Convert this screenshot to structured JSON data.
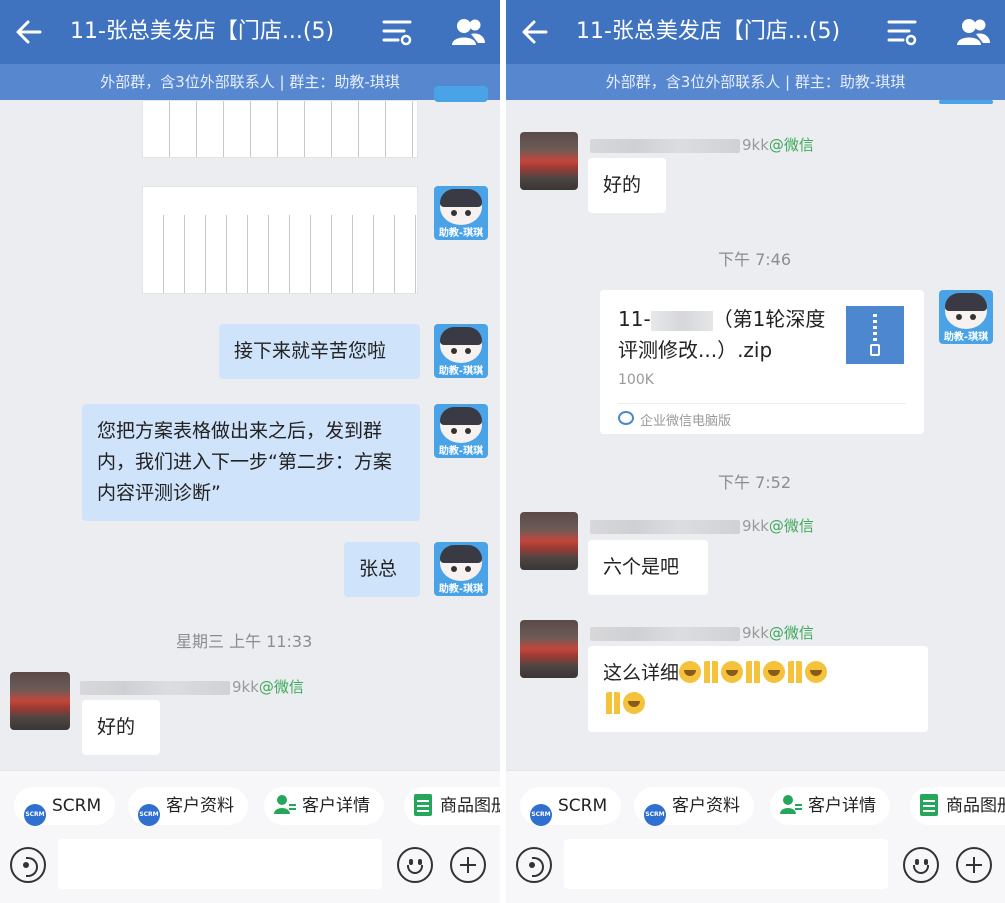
{
  "header": {
    "title": "11-张总美发店【门店...(5)",
    "subtitle": "外部群，含3位外部联系人 | 群主：助教-琪琪"
  },
  "left_chat": {
    "msg_line_1": "接下来就辛苦您啦",
    "msg_long": "您把方案表格做出来之后，发到群内，我们进入下一步“第二步：方案内容评测诊断”",
    "msg_name": "张总",
    "time_1": "星期三  上午 11:33",
    "nick_suffix": "9kk",
    "nick_tag": "@微信",
    "reply_1": "好的"
  },
  "right_chat": {
    "nick_suffix": "9kk",
    "nick_tag": "@微信",
    "reply_1": "好的",
    "time_1": "下午 7:46",
    "file": {
      "name_prefix": "11-",
      "name_rest": "（第1轮深度评测修改...）.zip",
      "size": "100K",
      "source": "企业微信电脑版"
    },
    "time_2": "下午 7:52",
    "reply_2": "六个是吧",
    "reply_3": "这么详细"
  },
  "helper_avatar_label": "助教-琪琪",
  "toolbar": {
    "chips": [
      "SCRM",
      "客户资料",
      "客户详情",
      "商品图册"
    ],
    "scrm_icon_text": "SCRM"
  },
  "icons": [
    "back-arrow-icon",
    "filter-icon",
    "members-icon",
    "voice-icon",
    "emoji-icon",
    "plus-icon",
    "zip-file-icon"
  ],
  "colors": {
    "header_bg": "#3f72bf",
    "subheader_bg": "#5787cf",
    "my_bubble": "#cfe3fb",
    "wechat_tag": "#3fa95b"
  }
}
